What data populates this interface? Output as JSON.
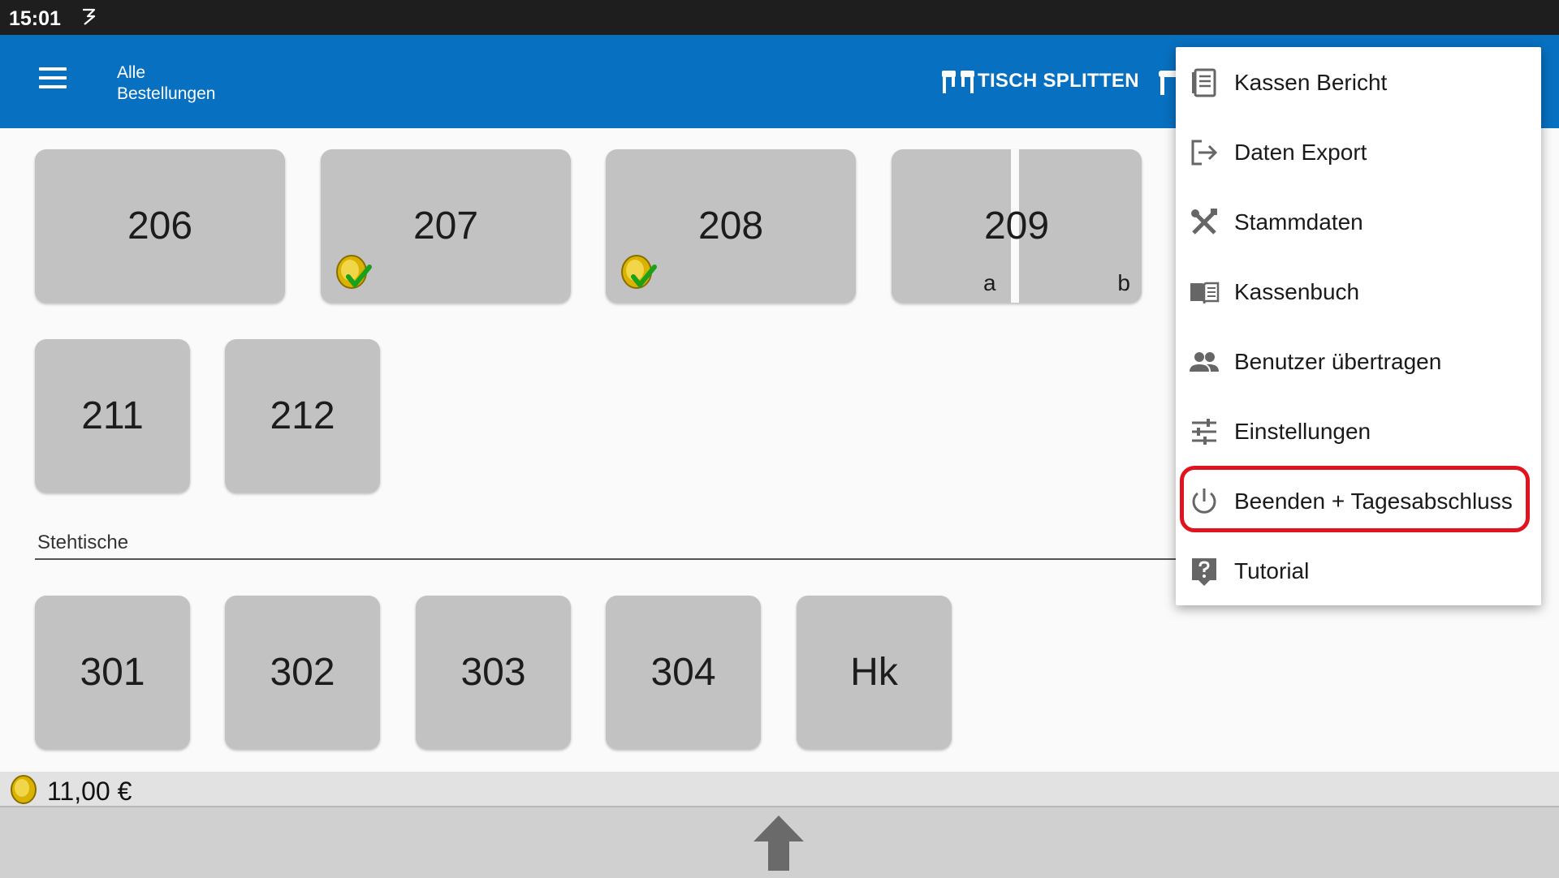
{
  "statusbar": {
    "time": "15:01"
  },
  "appbar": {
    "title_line1": "Alle",
    "title_line2": "Bestellungen",
    "split_label": "TISCH SPLITTEN"
  },
  "tables_row1": [
    "206",
    "207",
    "208",
    "209"
  ],
  "split_table": {
    "left": "a",
    "right": "b"
  },
  "tables_row2": [
    "211",
    "212"
  ],
  "section": {
    "label": "Stehtische"
  },
  "tables_row3": [
    "301",
    "302",
    "303",
    "304",
    "Hk"
  ],
  "total": {
    "amount": "11,00 €"
  },
  "menu": {
    "items": [
      {
        "label": "Kassen Bericht",
        "icon": "report-icon"
      },
      {
        "label": "Daten Export",
        "icon": "export-icon"
      },
      {
        "label": "Stammdaten",
        "icon": "tools-icon"
      },
      {
        "label": "Kassenbuch",
        "icon": "book-icon"
      },
      {
        "label": "Benutzer übertragen",
        "icon": "users-icon"
      },
      {
        "label": "Einstellungen",
        "icon": "sliders-icon"
      },
      {
        "label": "Beenden + Tagesabschluss",
        "icon": "power-icon"
      },
      {
        "label": "Tutorial",
        "icon": "help-icon"
      }
    ],
    "highlighted_item": "Beenden + Tagesabschluss"
  },
  "colors": {
    "appbar": "#0870c0",
    "highlight": "#e0141e",
    "table_tile": "#c2c2c2"
  }
}
